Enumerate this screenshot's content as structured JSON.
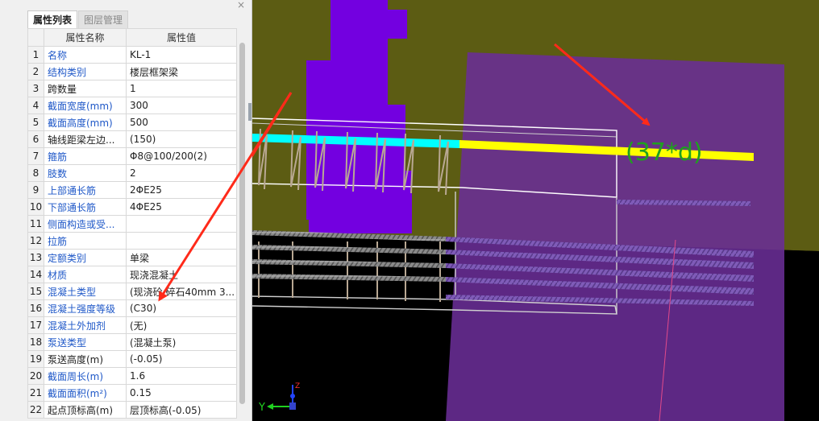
{
  "panel": {
    "close_glyph": "×",
    "tabs": [
      {
        "label": "属性列表",
        "active": true
      },
      {
        "label": "图层管理",
        "active": false
      }
    ],
    "columns": {
      "num": "",
      "name": "属性名称",
      "value": "属性值"
    },
    "rows": [
      {
        "num": "1",
        "name": "名称",
        "value": "KL-1",
        "name_color": "blue"
      },
      {
        "num": "2",
        "name": "结构类别",
        "value": "楼层框架梁",
        "name_color": "blue"
      },
      {
        "num": "3",
        "name": "跨数量",
        "value": "1",
        "name_color": "black"
      },
      {
        "num": "4",
        "name": "截面宽度(mm)",
        "value": "300",
        "name_color": "blue"
      },
      {
        "num": "5",
        "name": "截面高度(mm)",
        "value": "500",
        "name_color": "blue"
      },
      {
        "num": "6",
        "name": "轴线距梁左边...",
        "value": "(150)",
        "name_color": "black"
      },
      {
        "num": "7",
        "name": "箍筋",
        "value": "Φ8@100/200(2)",
        "name_color": "blue"
      },
      {
        "num": "8",
        "name": "肢数",
        "value": "2",
        "name_color": "blue"
      },
      {
        "num": "9",
        "name": "上部通长筋",
        "value": "2ΦE25",
        "name_color": "blue"
      },
      {
        "num": "10",
        "name": "下部通长筋",
        "value": "4ΦE25",
        "name_color": "blue"
      },
      {
        "num": "11",
        "name": "侧面构造或受...",
        "value": "",
        "name_color": "blue"
      },
      {
        "num": "12",
        "name": "拉筋",
        "value": "",
        "name_color": "blue"
      },
      {
        "num": "13",
        "name": "定额类别",
        "value": "单梁",
        "name_color": "blue"
      },
      {
        "num": "14",
        "name": "材质",
        "value": "现浇混凝土",
        "name_color": "blue"
      },
      {
        "num": "15",
        "name": "混凝土类型",
        "value": "(现浇砼 碎石40mm 3...",
        "name_color": "blue"
      },
      {
        "num": "16",
        "name": "混凝土强度等级",
        "value": "(C30)",
        "name_color": "blue"
      },
      {
        "num": "17",
        "name": "混凝土外加剂",
        "value": "(无)",
        "name_color": "blue"
      },
      {
        "num": "18",
        "name": "泵送类型",
        "value": "(混凝土泵)",
        "name_color": "blue"
      },
      {
        "num": "19",
        "name": "泵送高度(m)",
        "value": "(-0.05)",
        "name_color": "black"
      },
      {
        "num": "20",
        "name": "截面周长(m)",
        "value": "1.6",
        "name_color": "blue",
        "value_color": "gray"
      },
      {
        "num": "21",
        "name": "截面面积(m²)",
        "value": "0.15",
        "name_color": "blue",
        "value_color": "gray"
      },
      {
        "num": "22",
        "name": "起点顶标高(m)",
        "value": "层顶标高(-0.05)",
        "name_color": "black"
      }
    ]
  },
  "viewport": {
    "annotation": "(37*d)",
    "axis_labels": {
      "y": "Y",
      "z": "Z"
    },
    "colors": {
      "olive_slab": "#5c5c13",
      "purple_column": "#7300e0",
      "purple_overlay": "#6a2e96",
      "top_bar_cyan": "#00ffff",
      "top_bar_yellow": "#ffff00",
      "annotation_green": "#1fa01f",
      "arrow_red": "#ff2a1a"
    }
  }
}
